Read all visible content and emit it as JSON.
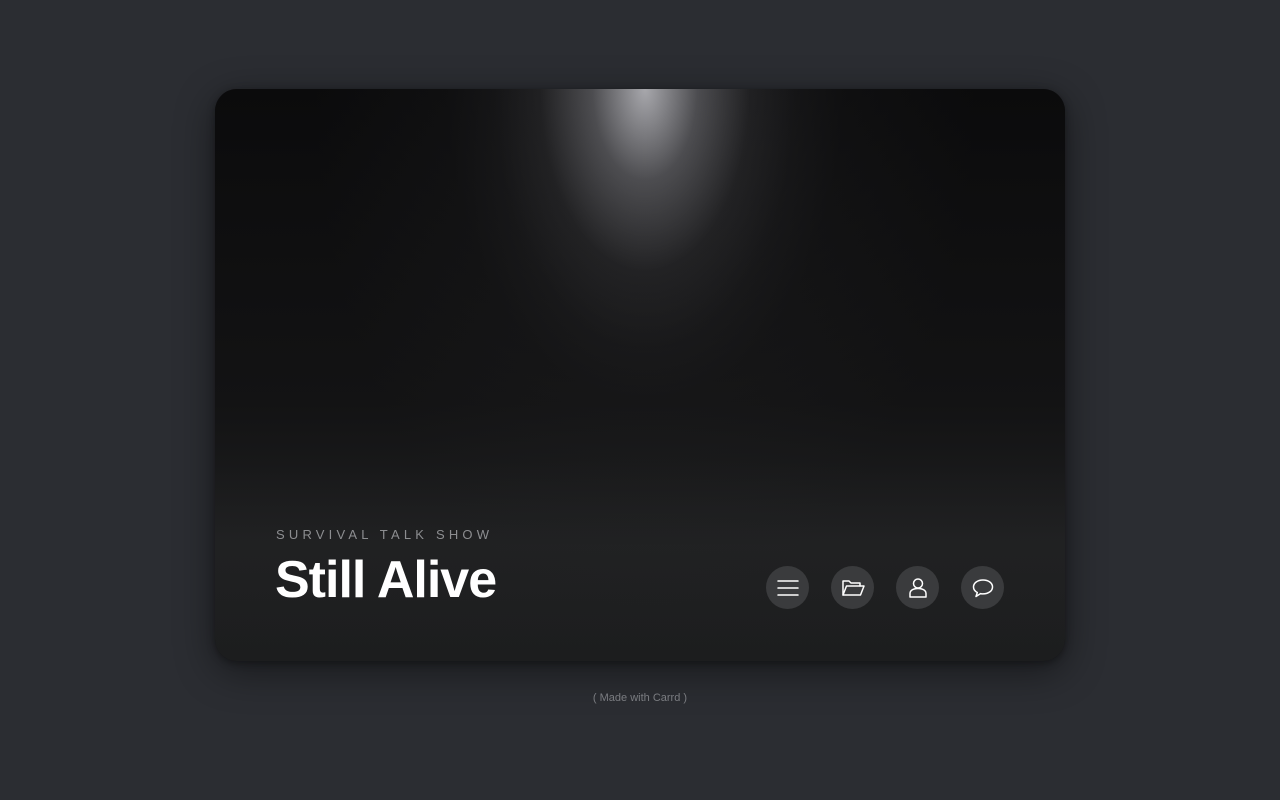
{
  "hero": {
    "subtitle": "SURVIVAL TALK SHOW",
    "title": "Still Alive"
  },
  "nav": {
    "buttons": [
      {
        "icon": "menu-icon"
      },
      {
        "icon": "folder-icon"
      },
      {
        "icon": "user-icon"
      },
      {
        "icon": "chat-bubble-icon"
      }
    ]
  },
  "footer": {
    "credit": "( Made with Carrd )"
  },
  "colors": {
    "page_background": "#2b2d32",
    "card_background": "#0f0f10",
    "button_background": "#3a3b3d",
    "title_color": "#ffffff",
    "subtitle_color": "#8c8d90"
  }
}
